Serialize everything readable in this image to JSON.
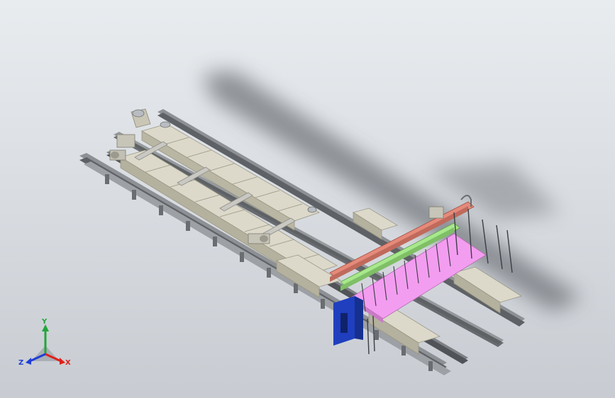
{
  "triad": {
    "x_label": "X",
    "y_label": "Y",
    "z_label": "Z",
    "colors": {
      "x": "#e0201b",
      "y": "#22a63a",
      "z": "#1f3ed6"
    }
  },
  "model_colors": {
    "rail": "#8d9094",
    "rail_dark": "#5e6165",
    "housing": "#d8d5c6",
    "housing_dark": "#a9a693",
    "beam_red": "#e58a7a",
    "beam_green": "#a8e88c",
    "platform_pink": "#f39df0",
    "cabinet_blue": "#1f3fbf",
    "frame_dark": "#3b3e44"
  }
}
